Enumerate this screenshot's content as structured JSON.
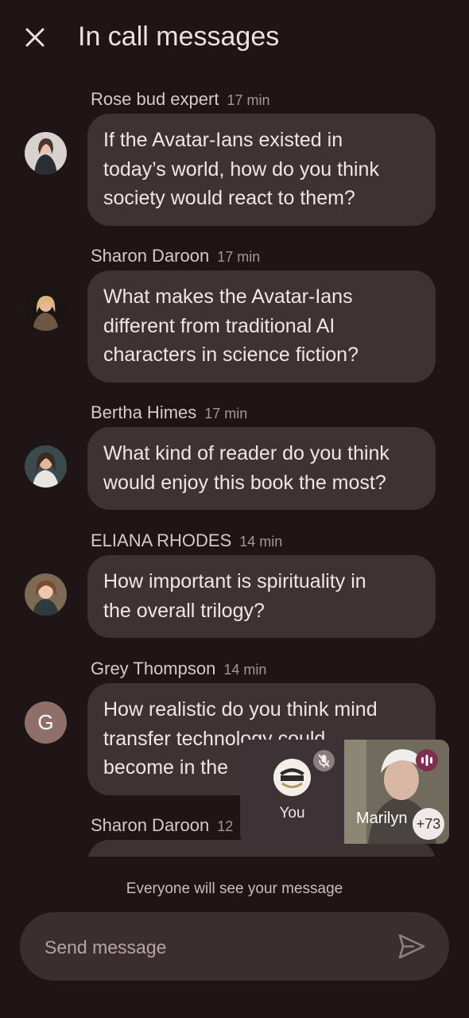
{
  "header": {
    "title": "In call messages",
    "close_icon": "close-icon"
  },
  "messages": [
    {
      "sender": "Rose bud expert",
      "time": "17 min",
      "lines": [
        "If the Avatar-Ians existed in",
        "today’s world, how do you think",
        "society would react to them?"
      ],
      "avatar": "photo"
    },
    {
      "sender": "Sharon Daroon",
      "time": "17 min",
      "lines": [
        "What makes the Avatar-Ians",
        "different from traditional AI",
        "characters in science fiction?"
      ],
      "avatar": "photo"
    },
    {
      "sender": "Bertha Himes",
      "time": "17 min",
      "lines": [
        "What kind of reader do you think",
        "would enjoy this book the most?"
      ],
      "avatar": "photo"
    },
    {
      "sender": "ELIANA RHODES",
      "time": "14 min",
      "lines": [
        "How important is spirituality in",
        "the overall trilogy?"
      ],
      "avatar": "photo"
    },
    {
      "sender": "Grey Thompson",
      "time": "14 min",
      "lines": [
        "How realistic do you think mind",
        "transfer technology could",
        "become in the"
      ],
      "avatar": "letter",
      "avatar_letter": "G"
    },
    {
      "sender": "Sharon Daroon",
      "time": "12",
      "lines": [],
      "avatar": "photo"
    }
  ],
  "composer": {
    "notice": "Everyone will see your message",
    "placeholder": "Send message",
    "send_icon": "send-icon"
  },
  "pip": {
    "self_label": "You",
    "remote_name": "Marilyn",
    "more_count": "+73",
    "colors": {
      "self_bg": "#3d3235",
      "speaking": "#7e2f4f"
    }
  }
}
